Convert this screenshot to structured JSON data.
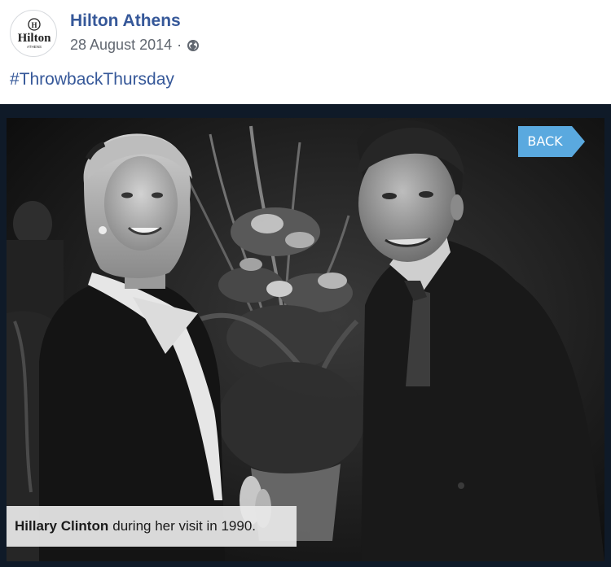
{
  "post": {
    "page_name": "Hilton Athens",
    "date": "28 August 2014",
    "separator": "·",
    "audience_icon": "globe-icon",
    "hashtag": "#ThrowbackThursday"
  },
  "avatar": {
    "logo_text": "Hilton",
    "logo_subtext": "ATHENS"
  },
  "photo": {
    "back_label": "BACK",
    "caption_bold": "Hillary Clinton",
    "caption_rest": "during her visit  in 1990."
  },
  "colors": {
    "link_blue": "#365899",
    "meta_gray": "#616770",
    "back_button_blue": "#5aa9df",
    "photo_frame": "#0f1a28"
  }
}
